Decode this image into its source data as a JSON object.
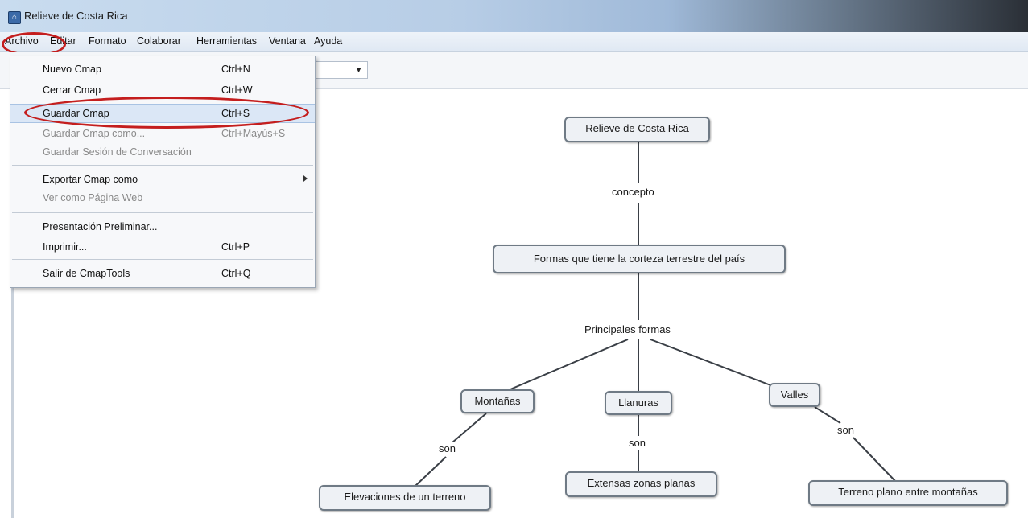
{
  "window": {
    "title": "Relieve de Costa Rica"
  },
  "menubar": {
    "items": [
      "Archivo",
      "Editar",
      "Formato",
      "Colaborar",
      "Herramientas",
      "Ventana",
      "Ayuda"
    ]
  },
  "file_menu": {
    "items": [
      {
        "label": "Nuevo Cmap",
        "shortcut": "Ctrl+N"
      },
      {
        "label": "Cerrar Cmap",
        "shortcut": "Ctrl+W"
      },
      {
        "label": "Guardar Cmap",
        "shortcut": "Ctrl+S"
      },
      {
        "label": "Guardar Cmap como...",
        "shortcut": "Ctrl+Mayús+S"
      },
      {
        "label": "Guardar Sesión de Conversación",
        "shortcut": ""
      },
      {
        "label": "Exportar Cmap como",
        "shortcut": ""
      },
      {
        "label": "Ver como Página Web",
        "shortcut": ""
      },
      {
        "label": "Presentación Preliminar...",
        "shortcut": ""
      },
      {
        "label": "Imprimir...",
        "shortcut": "Ctrl+P"
      },
      {
        "label": "Salir de CmapTools",
        "shortcut": "Ctrl+Q"
      }
    ]
  },
  "concept_map": {
    "nodes": {
      "root": "Relieve de Costa Rica",
      "formas": "Formas que tiene la corteza terrestre del país",
      "montanas": "Montañas",
      "llanuras": "Llanuras",
      "valles": "Valles",
      "elevaciones": "Elevaciones de un terreno",
      "extensas": "Extensas zonas planas",
      "terreno": "Terreno plano entre montañas"
    },
    "links": {
      "concepto": "concepto",
      "principales": "Principales formas",
      "son_montanas": "son",
      "son_llanuras": "son",
      "son_valles": "son"
    }
  },
  "colors": {
    "highlight_circle": "#c41e1e",
    "node_border": "#6f7a85"
  }
}
